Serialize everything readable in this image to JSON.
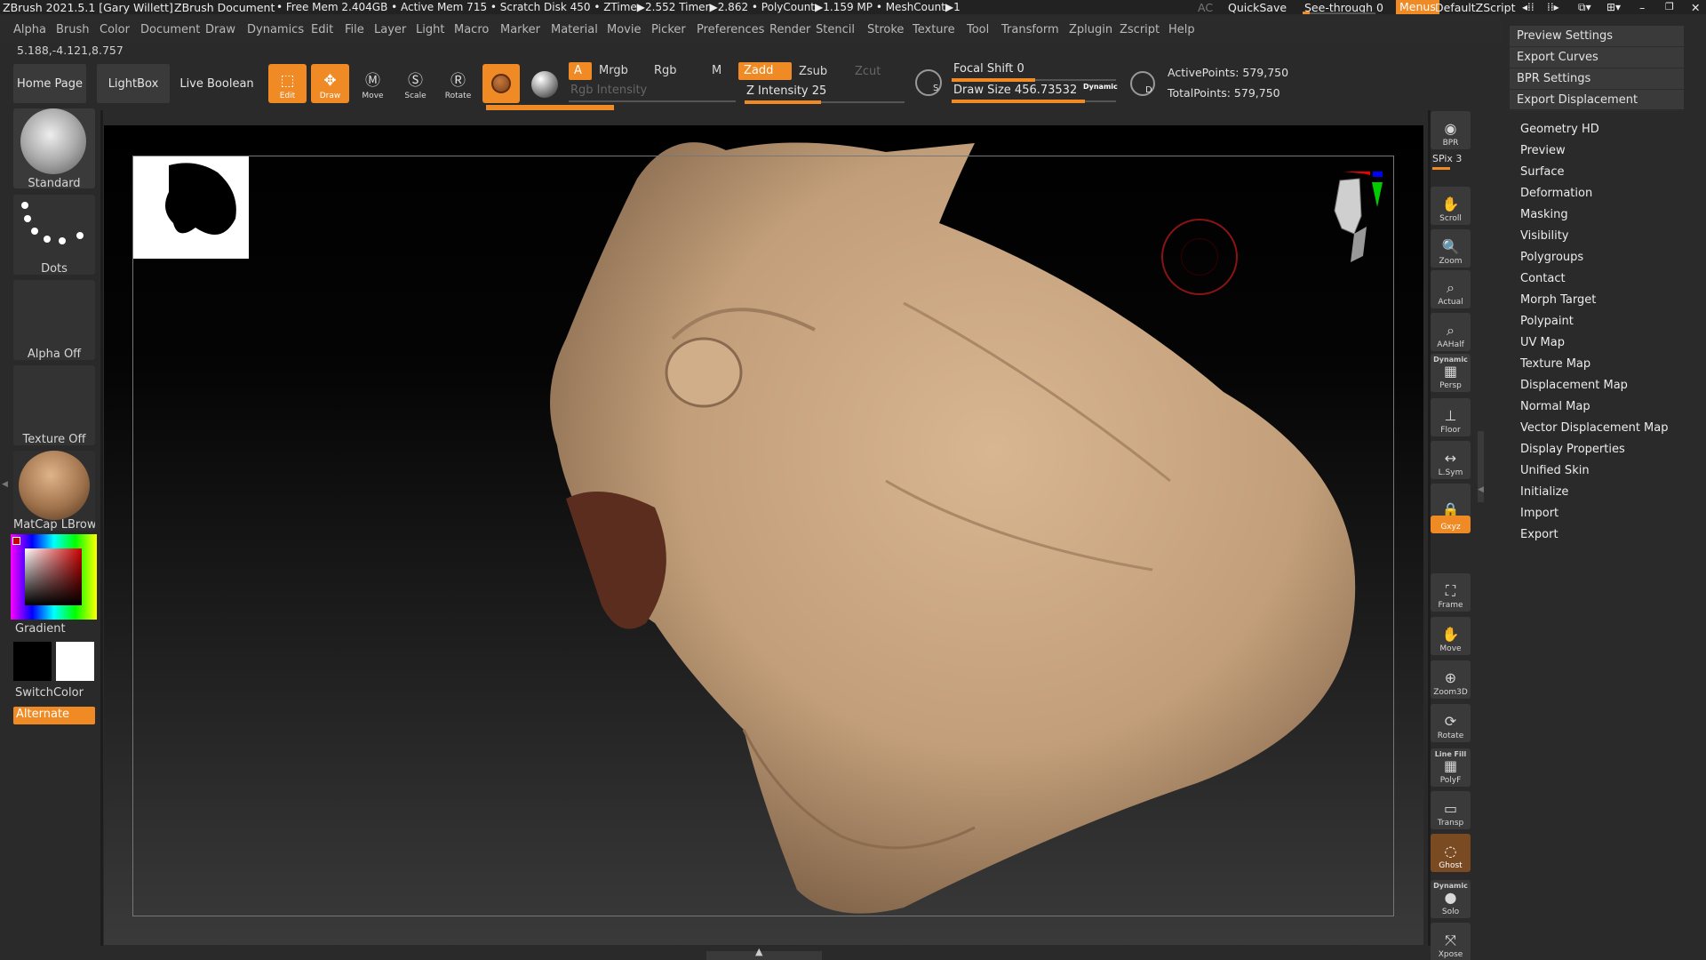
{
  "title_bar": {
    "app_version": "ZBrush 2021.5.1 [Gary Willett]",
    "document": "ZBrush Document",
    "stats": "• Free Mem 2.404GB • Active Mem 715 • Scratch Disk 450 • ZTime▶2.552 Timer▶2.862 • PolyCount▶1.159 MP • MeshCount▶1",
    "ac": "AC",
    "quicksave": "QuickSave",
    "see_through": "See-through",
    "see_through_value": "0",
    "menus": "Menus",
    "default_zscript": "DefaultZScript"
  },
  "menubar": {
    "items": [
      "Alpha",
      "Brush",
      "Color",
      "Document",
      "Draw",
      "Dynamics",
      "Edit",
      "File",
      "Layer",
      "Light",
      "Macro",
      "Marker",
      "Material",
      "Movie",
      "Picker",
      "Preferences",
      "Render",
      "Stencil",
      "Stroke",
      "Texture",
      "Tool",
      "Transform",
      "Zplugin",
      "Zscript",
      "Help"
    ]
  },
  "coords": "5.188,-4.121,8.757",
  "shelf": {
    "home_page": "Home Page",
    "lightbox": "LightBox",
    "live_boolean": "Live Boolean",
    "tools": [
      {
        "label": "Edit",
        "icon": "edit-icon",
        "on": true
      },
      {
        "label": "Draw",
        "icon": "draw-icon",
        "on": true
      },
      {
        "label": "Move",
        "icon": "move-icon",
        "on": false
      },
      {
        "label": "Scale",
        "icon": "scale-icon",
        "on": false
      },
      {
        "label": "Rotate",
        "icon": "rotate-icon",
        "on": false
      }
    ],
    "a_btn": "A",
    "mrgb": "Mrgb",
    "rgb": "Rgb",
    "m": "M",
    "zadd": "Zadd",
    "zsub": "Zsub",
    "zcut": "Zcut",
    "rgb_intensity": "Rgb Intensity",
    "z_intensity": "Z Intensity",
    "z_intensity_value": "25",
    "focal_shift": "Focal Shift",
    "focal_shift_value": "0",
    "draw_size": "Draw Size",
    "draw_size_value": "456.73532",
    "dynamic": "Dynamic",
    "active_points": "ActivePoints: 579,750",
    "total_points": "TotalPoints: 579,750"
  },
  "left_tray": {
    "brush": "Standard",
    "stroke": "Dots",
    "alpha": "Alpha Off",
    "texture": "Texture Off",
    "material": "MatCap LBrownC",
    "gradient": "Gradient",
    "switch_color": "SwitchColor",
    "alternate": "Alternate"
  },
  "right_shelf": {
    "bpr": "BPR",
    "spix": "SPix 3",
    "buttons": [
      {
        "label": "Scroll",
        "icon": "scroll-icon",
        "top_label": ""
      },
      {
        "label": "Zoom",
        "icon": "zoom-icon",
        "top_label": ""
      },
      {
        "label": "Actual",
        "icon": "actual-icon",
        "top_label": ""
      },
      {
        "label": "AAHalf",
        "icon": "aahalf-icon",
        "top_label": ""
      },
      {
        "label": "Persp",
        "icon": "persp-icon",
        "top_label": "Dynamic"
      },
      {
        "label": "Floor",
        "icon": "floor-icon",
        "top_label": ""
      },
      {
        "label": "L.Sym",
        "icon": "lsym-icon",
        "top_label": ""
      },
      {
        "label": "",
        "icon": "lock-icon",
        "top_label": ""
      },
      {
        "label": "Frame",
        "icon": "frame-icon",
        "top_label": ""
      },
      {
        "label": "Move",
        "icon": "move-icon",
        "top_label": ""
      },
      {
        "label": "Zoom3D",
        "icon": "zoom3d-icon",
        "top_label": ""
      },
      {
        "label": "Rotate",
        "icon": "rotate-icon",
        "top_label": ""
      },
      {
        "label": "PolyF",
        "icon": "polyf-icon",
        "top_label": "Line Fill"
      },
      {
        "label": "Transp",
        "icon": "transp-icon",
        "top_label": ""
      },
      {
        "label": "Ghost",
        "icon": "ghost-icon",
        "top_label": ""
      },
      {
        "label": "Solo",
        "icon": "solo-icon",
        "top_label": "Dynamic"
      },
      {
        "label": "Xpose",
        "icon": "xpose-icon",
        "top_label": ""
      }
    ],
    "xyz": "Gxyz"
  },
  "right_panel": {
    "popup": [
      "Preview Settings",
      "Export Curves",
      "BPR Settings",
      "Export Displacement"
    ],
    "items": [
      "Geometry HD",
      "Preview",
      "Surface",
      "Deformation",
      "Masking",
      "Visibility",
      "Polygroups",
      "Contact",
      "Morph Target",
      "Polypaint",
      "UV Map",
      "Texture Map",
      "Displacement Map",
      "Normal Map",
      "Vector Displacement Map",
      "Display Properties",
      "Unified Skin",
      "Initialize",
      "Import",
      "Export"
    ]
  }
}
